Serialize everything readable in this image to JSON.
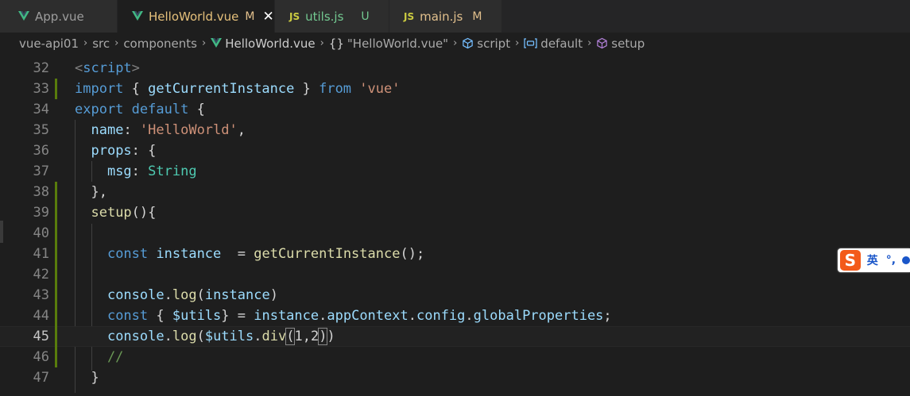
{
  "tabs": [
    {
      "label": "App.vue",
      "icon": "vue-icon",
      "status": "",
      "active": false
    },
    {
      "label": "HelloWorld.vue",
      "icon": "vue-icon",
      "status": "M",
      "active": true,
      "close": "✕"
    },
    {
      "label": "utils.js",
      "icon": "js-icon",
      "icon_text": "JS",
      "status": "U",
      "active": false
    },
    {
      "label": "main.js",
      "icon": "js-icon",
      "icon_text": "JS",
      "status": "M",
      "active": false
    }
  ],
  "breadcrumb": {
    "items": [
      "vue-api01",
      "src",
      "components",
      "HelloWorld.vue",
      "\"HelloWorld.vue\"",
      "script",
      "default",
      "setup"
    ],
    "braces": "{}"
  },
  "editor": {
    "active_line": 45,
    "lines": [
      {
        "n": "32",
        "text": "<script>"
      },
      {
        "n": "33",
        "text": "import { getCurrentInstance } from 'vue'"
      },
      {
        "n": "34",
        "text": "export default {"
      },
      {
        "n": "35",
        "text": "  name: 'HelloWorld',"
      },
      {
        "n": "36",
        "text": "  props: {"
      },
      {
        "n": "37",
        "text": "    msg: String"
      },
      {
        "n": "38",
        "text": "  },"
      },
      {
        "n": "39",
        "text": "  setup(){"
      },
      {
        "n": "40",
        "text": ""
      },
      {
        "n": "41",
        "text": "    const instance  = getCurrentInstance();"
      },
      {
        "n": "42",
        "text": ""
      },
      {
        "n": "43",
        "text": "    console.log(instance)"
      },
      {
        "n": "44",
        "text": "    const { $utils} = instance.appContext.config.globalProperties;"
      },
      {
        "n": "45",
        "text": "    console.log($utils.div(1,2))"
      },
      {
        "n": "46",
        "text": "    //"
      },
      {
        "n": "47",
        "text": "  }"
      }
    ]
  },
  "ime": {
    "logo": "S",
    "mode": "英",
    "punct": "°,"
  },
  "colors": {
    "vue_green": "#41b883",
    "js_yellow": "#cbcb41",
    "modified": "#e2c08d",
    "untracked": "#73c991",
    "git_added": "#587c0c"
  }
}
